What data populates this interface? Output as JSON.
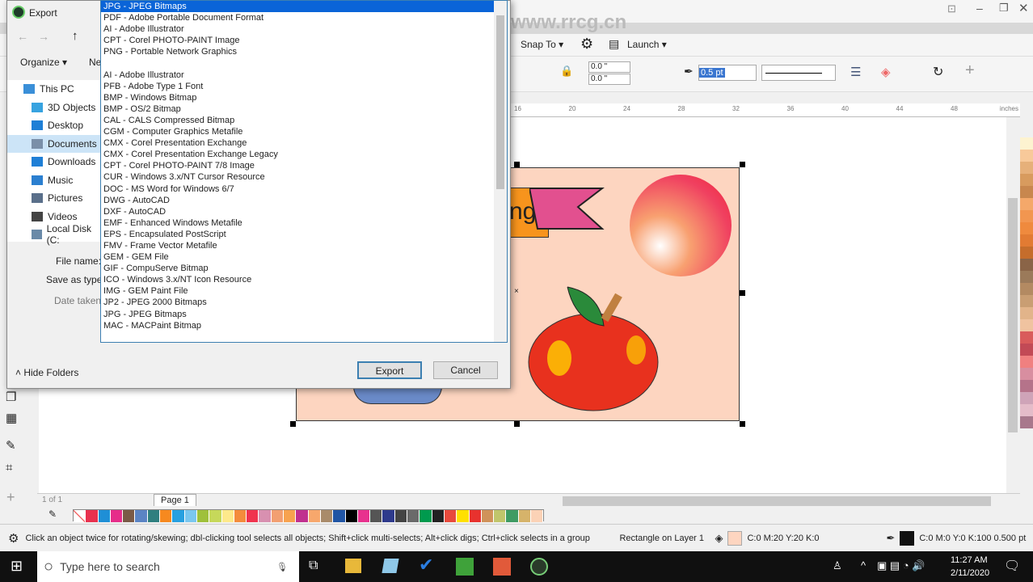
{
  "watermark": "www.rrcg.cn",
  "app": {
    "snap_to": "Snap To",
    "launch": "Launch",
    "pos_x": "0.0 \"",
    "pos_y": "0.0 \"",
    "outline_width": "0.5 pt",
    "ruler_ticks": [
      "16",
      "20",
      "24",
      "28",
      "32",
      "36",
      "40",
      "44",
      "48"
    ],
    "ruler_unit": "inches",
    "page_nav": "1 of 1",
    "page_tab": "Page 1",
    "banner_text": "ng",
    "palette": [
      "#e8314f",
      "#1f8fd6",
      "#e62d8a",
      "#7a5a47",
      "#5b84c4",
      "#2f7f7f",
      "#f6891f",
      "#27a0e0",
      "#7ac7ef",
      "#9fc03b",
      "#c6d85a",
      "#fde98b",
      "#f48c3c",
      "#f0334f",
      "#d890b0",
      "#f29f71",
      "#f7a24f",
      "#c0308f",
      "#f7a76c",
      "#a98b6a",
      "#2055a4",
      "#000000",
      "#e8318e",
      "#555555",
      "#2e3a8c",
      "#444444",
      "#6a6a6a",
      "#009a4e",
      "#222222",
      "#e84a3c",
      "#ffe000",
      "#e8322e",
      "#d0925a",
      "#c0c56b",
      "#3f9b63",
      "#d6b36a",
      "#fbd2b6"
    ],
    "right_palette": [
      "#fdf3d0",
      "#f8c99a",
      "#e6b07a",
      "#d89b5e",
      "#c8874e",
      "#f4a86a",
      "#f29650",
      "#ef8a3e",
      "#e27b33",
      "#c56d2c",
      "#8a6447",
      "#9b7a5a",
      "#b38a62",
      "#c99e73",
      "#e2b48a",
      "#f0c3a0",
      "#d95b5b",
      "#c24a56",
      "#f08080",
      "#d88ea0",
      "#b5738a",
      "#cfa4b8",
      "#e4bcc9",
      "#a8788c"
    ]
  },
  "status": {
    "hint": "Click an object twice for rotating/skewing; dbl-clicking tool selects all objects; Shift+click multi-selects; Alt+click digs; Ctrl+click selects in a group",
    "object": "Rectangle on Layer 1",
    "fill": "C:0 M:20 Y:20 K:0",
    "fill_color": "#fdd5c0",
    "outline": "C:0 M:0 Y:0 K:100  0.500 pt"
  },
  "dialog": {
    "title": "Export",
    "organize": "Organize ▾",
    "new_folder": "Ne",
    "nav": [
      {
        "label": "This PC",
        "icon": "pc-icon",
        "color": "#3a8fd8"
      },
      {
        "label": "3D Objects",
        "icon": "cube-icon",
        "color": "#37a3e0"
      },
      {
        "label": "Desktop",
        "icon": "desktop-icon",
        "color": "#1f7fd6"
      },
      {
        "label": "Documents",
        "icon": "documents-icon",
        "color": "#7a8fa8"
      },
      {
        "label": "Downloads",
        "icon": "download-icon",
        "color": "#1f7fd6"
      },
      {
        "label": "Music",
        "icon": "music-icon",
        "color": "#2b7fd0"
      },
      {
        "label": "Pictures",
        "icon": "pictures-icon",
        "color": "#5a6f8a"
      },
      {
        "label": "Videos",
        "icon": "videos-icon",
        "color": "#444"
      },
      {
        "label": "Local Disk (C:",
        "icon": "disk-icon",
        "color": "#6a8aa8"
      }
    ],
    "file_name_label": "File name:",
    "save_as_type_label": "Save as type:",
    "date_taken_label": "Date taken:",
    "hide_folders": "Hide Folders",
    "export": "Export",
    "cancel": "Cancel",
    "types": [
      "JPG - JPEG Bitmaps",
      "PDF - Adobe Portable Document Format",
      "AI - Adobe Illustrator",
      "CPT - Corel PHOTO-PAINT Image",
      "PNG - Portable Network Graphics",
      "",
      "AI - Adobe Illustrator",
      "PFB - Adobe Type 1 Font",
      "BMP - Windows Bitmap",
      "BMP - OS/2 Bitmap",
      "CAL - CALS Compressed Bitmap",
      "CGM - Computer Graphics Metafile",
      "CMX - Corel Presentation Exchange",
      "CMX - Corel Presentation Exchange Legacy",
      "CPT - Corel PHOTO-PAINT 7/8 Image",
      "CUR - Windows 3.x/NT Cursor Resource",
      "DOC - MS Word for Windows 6/7",
      "DWG - AutoCAD",
      "DXF - AutoCAD",
      "EMF - Enhanced Windows Metafile",
      "EPS - Encapsulated PostScript",
      "FMV - Frame Vector Metafile",
      "GEM - GEM File",
      "GIF - CompuServe Bitmap",
      "ICO - Windows 3.x/NT Icon Resource",
      "IMG - GEM Paint File",
      "JP2 - JPEG 2000 Bitmaps",
      "JPG - JPEG Bitmaps",
      "MAC - MACPaint Bitmap"
    ],
    "selected_index": 0
  },
  "taskbar": {
    "search_placeholder": "Type here to search",
    "time": "11:27 AM",
    "date": "2/11/2020"
  }
}
